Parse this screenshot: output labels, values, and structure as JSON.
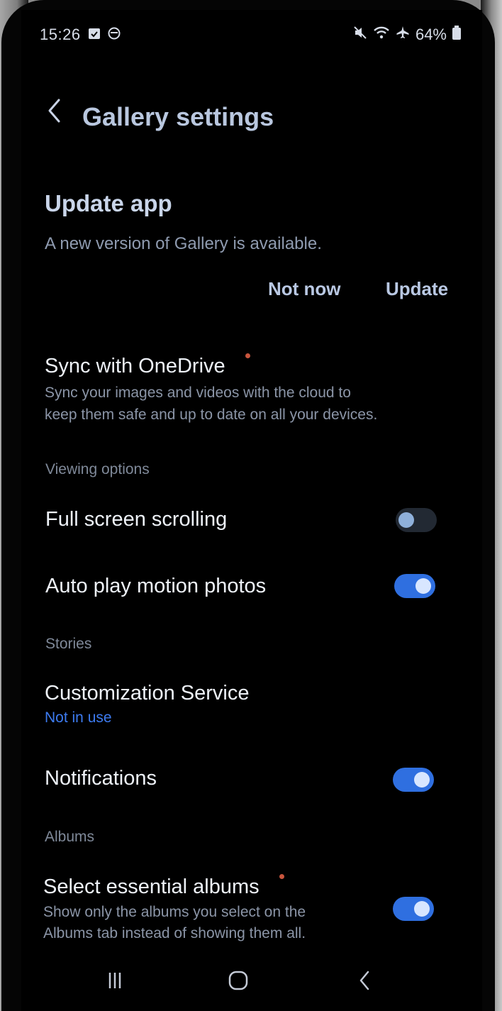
{
  "status_bar": {
    "time": "15:26",
    "battery": "64%",
    "left_icons": [
      "calendar-check-icon",
      "circle-status-icon"
    ],
    "right_icons": [
      "mute-icon",
      "wifi-icon",
      "airplane-icon",
      "battery-icon"
    ]
  },
  "header": {
    "back_icon": "chevron-left-icon",
    "title": "Gallery settings"
  },
  "update_card": {
    "title": "Update app",
    "description": "A new version of Gallery is available.",
    "not_now_label": "Not now",
    "update_label": "Update"
  },
  "sync": {
    "title": "Sync with OneDrive",
    "line1": "Sync your images and videos with the cloud to",
    "line2": "keep them safe and up to date on all your devices."
  },
  "viewing": {
    "header": "Viewing options",
    "full_screen_label": "Full screen scrolling",
    "full_screen_on": false,
    "auto_play_label": "Auto play motion photos",
    "auto_play_on": true
  },
  "stories": {
    "header": "Stories",
    "customization_title": "Customization Service",
    "customization_status": "Not in use",
    "notifications_label": "Notifications",
    "notifications_on": true
  },
  "albums": {
    "header": "Albums",
    "essential_title": "Select essential albums",
    "essential_line1": "Show only the albums you select on the",
    "essential_line2": "Albums tab instead of showing them all.",
    "essential_on": true
  },
  "nav_bar": {
    "recents_icon": "recents-icon",
    "home_icon": "home-icon",
    "back_icon": "back-icon"
  },
  "colors": {
    "toggle_on": "#2f6fe0",
    "accent_blue": "#3d7bf0",
    "new_badge_dot": "#c8553d"
  }
}
